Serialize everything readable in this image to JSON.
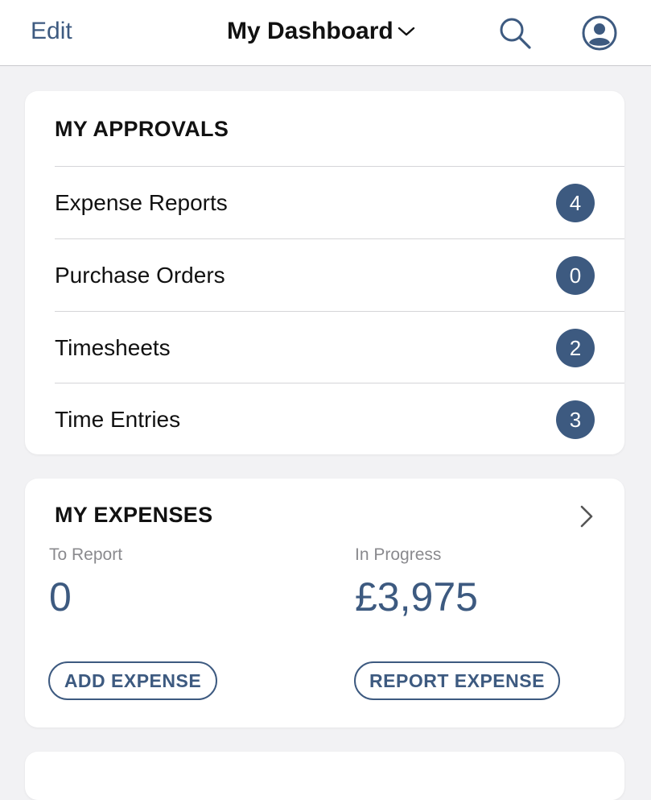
{
  "header": {
    "edit_label": "Edit",
    "title": "My Dashboard",
    "icons": [
      "chevron-down-icon",
      "search-icon",
      "account-icon"
    ]
  },
  "approvals": {
    "title": "MY APPROVALS",
    "items": [
      {
        "label": "Expense Reports",
        "count": "4"
      },
      {
        "label": "Purchase Orders",
        "count": "0"
      },
      {
        "label": "Timesheets",
        "count": "2"
      },
      {
        "label": "Time Entries",
        "count": "3"
      }
    ]
  },
  "expenses": {
    "title": "MY EXPENSES",
    "to_report_label": "To Report",
    "to_report_value": "0",
    "in_progress_label": "In Progress",
    "in_progress_value": "£3,975",
    "add_button": "ADD EXPENSE",
    "report_button": "REPORT EXPENSE"
  },
  "colors": {
    "accent": "#3d5a80",
    "background": "#f2f2f4",
    "card": "#ffffff",
    "muted_text": "#8a8a8e"
  }
}
